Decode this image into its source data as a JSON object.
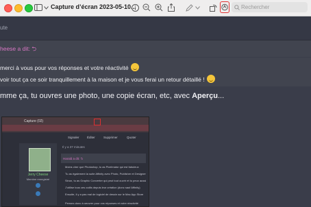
{
  "toolbar": {
    "title": "Capture d’écran 2023-05-10...",
    "search_placeholder": "Rechercher",
    "icons": [
      "sidebar-icon",
      "chevron-down-icon",
      "info-icon",
      "zoom-out-icon",
      "zoom-in-icon",
      "share-icon",
      "markup-icon",
      "markup-chevron-icon",
      "rotate-icon",
      "highlight-icon",
      "search-icon"
    ]
  },
  "content": {
    "top_label": "ute",
    "quote_author": "heese a dit: ⮌",
    "quote_line1": "merci à vous pour vos réponses et votre réactivité",
    "quote_line2": "voir tout ça ce soir tranquillement à la maison et je vous ferai un retour détaillé !",
    "main_text_before": "mme ça, tu ouvres une photo, une copie écran, etc, avec ",
    "main_text_bold": "Aperçu",
    "main_text_after": "..."
  },
  "embedded": {
    "window_title": "Capture (02)",
    "tabs": [
      "Signaler",
      "Éditer",
      "Supprimer",
      "Quoter"
    ],
    "time_label": "Il y a 37 minutes",
    "quote_author": "Harald a dit: ⮌",
    "user_name": "Jerry Cheese",
    "user_role": "Membre enregistré",
    "lines": [
      "Moins cher que Photoshop, tu as Pixelmator qui est fabuleux",
      "Tu as également la suite Affinity avec Photo, Publisher et Designer",
      "Sinon, tu as Graphic Converter qui peut tout ouvrir et tu peux aussi",
      "J’utilise tous ces outils depuis leur création (donc sauf Affinity)",
      "Ensuite, il y a pas mal de logiciel de dessin sur le Mac App Store",
      "Pensez-donc à oeuvrer pour vos réponses et votre réactivité"
    ]
  },
  "colors": {
    "quote_author": "#d877c4",
    "highlight_border": "#e03030",
    "background": "#3a3d4a"
  }
}
